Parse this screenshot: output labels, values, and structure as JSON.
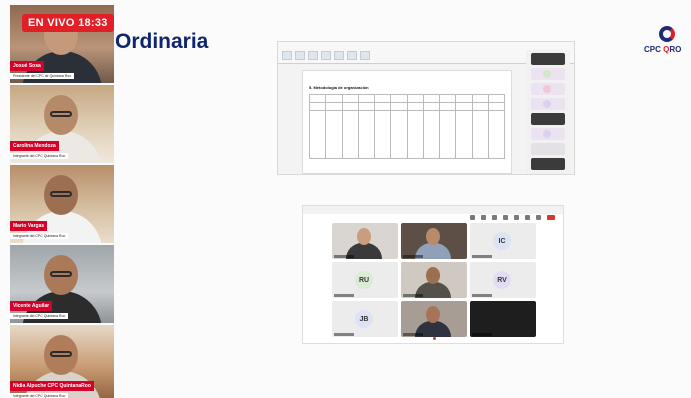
{
  "live": {
    "label": "EN VIVO 18:33"
  },
  "title": "Ordinaria",
  "logo": {
    "text_main": "CPC QRO",
    "text_red": "Q"
  },
  "speakers": [
    {
      "name": "Josué Sosa",
      "role": "Presidente del CPC de Quintana Roo"
    },
    {
      "name": "Carolina Mendoza",
      "role": "Integrante del CPC Quintana Roo"
    },
    {
      "name": "Mario Vargas",
      "role": "Integrante del CPC Quintana Roo"
    },
    {
      "name": "Vicente Aguilar",
      "role": "Integrante del CPC Quintana Roo"
    },
    {
      "name": "Nidia Alpuche CPC QuintanaRoo",
      "role": "Integrante del CPC Quintana Roo"
    }
  ],
  "spreadsheet": {
    "section": "5. Metodología de organización"
  },
  "meeting": {
    "cells": [
      {
        "type": "person",
        "initials": ""
      },
      {
        "type": "person",
        "initials": ""
      },
      {
        "type": "initials",
        "initials": "IC",
        "color": "#dbe3f5"
      },
      {
        "type": "initials",
        "initials": "RU",
        "color": "#d9ecd4"
      },
      {
        "type": "person",
        "initials": ""
      },
      {
        "type": "initials",
        "initials": "RV",
        "color": "#e4ddf2"
      },
      {
        "type": "initials",
        "initials": "JB",
        "color": "#dde3f5"
      },
      {
        "type": "person",
        "initials": ""
      },
      {
        "type": "dark",
        "initials": ""
      }
    ]
  },
  "colors": {
    "accent_red": "#e01f26",
    "brand_navy": "#10256b"
  }
}
